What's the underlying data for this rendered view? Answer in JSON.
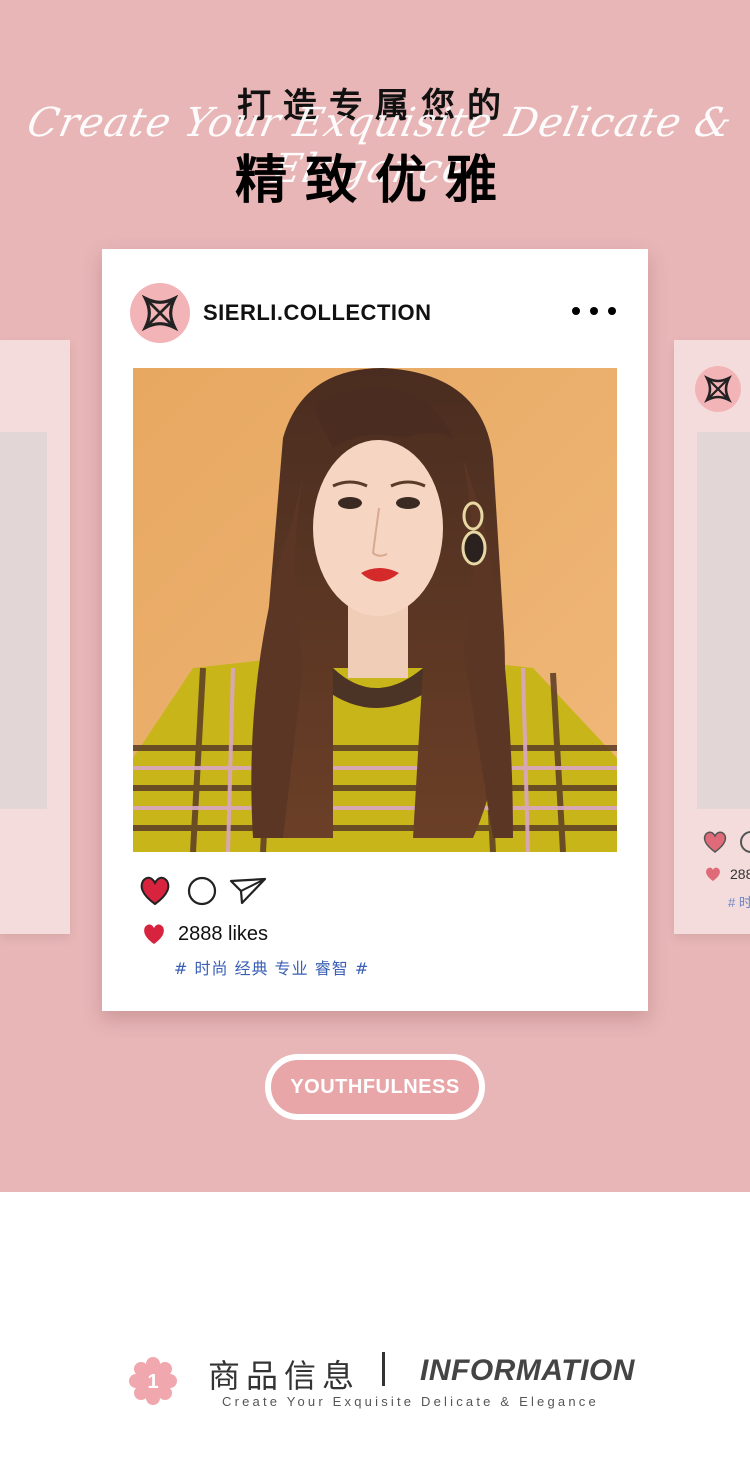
{
  "hero": {
    "title_line1": "打造专属您的",
    "script_text": "Create Your Exquisite Delicate & Elegance",
    "title_line2": "精致优雅",
    "background_color": "#e8b6b7"
  },
  "post": {
    "username": "SIERLI.COLLECTION",
    "more_icon": "more-dots-icon",
    "likes_text": "2888 likes",
    "tags": "# 时尚 经典 专业 睿智 #",
    "like_color": "#d8233f",
    "tag_color": "#3a5fb5"
  },
  "right_preview": {
    "likes_text": "288",
    "tags": "# 时"
  },
  "pill_button": {
    "label": "YOUTHFULNESS"
  },
  "footer": {
    "badge_number": "1",
    "title_cn": "商品信息",
    "title_en": "INFORMATION",
    "subtitle": "Create Your Exquisite Delicate & Elegance"
  }
}
